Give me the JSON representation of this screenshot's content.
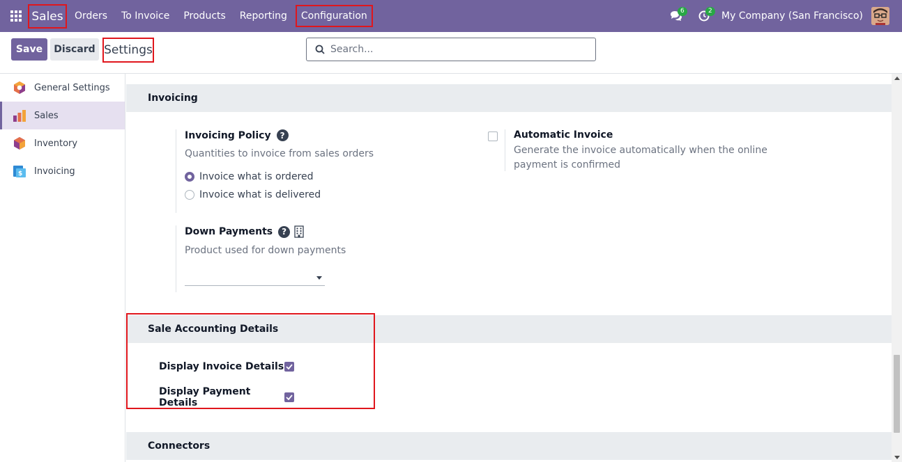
{
  "navbar": {
    "app_name": "Sales",
    "menu": [
      "Orders",
      "To Invoice",
      "Products",
      "Reporting",
      "Configuration"
    ],
    "messages_count": "6",
    "activities_count": "2",
    "company": "My Company (San Francisco)"
  },
  "control": {
    "save_label": "Save",
    "discard_label": "Discard",
    "title": "Settings",
    "search_placeholder": "Search..."
  },
  "sidebar": {
    "items": [
      {
        "label": "General Settings",
        "icon": "settings-hexagon-icon"
      },
      {
        "label": "Sales",
        "icon": "sales-chart-icon",
        "active": true
      },
      {
        "label": "Inventory",
        "icon": "inventory-box-icon"
      },
      {
        "label": "Invoicing",
        "icon": "invoicing-icon"
      }
    ]
  },
  "invoicing": {
    "header": "Invoicing",
    "policy_title": "Invoicing Policy",
    "policy_desc": "Quantities to invoice from sales orders",
    "option_ordered": "Invoice what is ordered",
    "option_delivered": "Invoice what is delivered",
    "selected_option": "Invoice what is ordered",
    "auto_invoice_title": "Automatic Invoice",
    "auto_invoice_desc": "Generate the invoice automatically when the online payment is confirmed",
    "auto_invoice_checked": false,
    "down_payments_title": "Down Payments",
    "down_payments_desc": "Product used for down payments",
    "down_payments_value": ""
  },
  "sale_accounting": {
    "header": "Sale Accounting Details",
    "invoice_details_label": "Display Invoice Details",
    "invoice_details_checked": true,
    "payment_details_label": "Display Payment Details",
    "payment_details_checked": true
  },
  "connectors": {
    "header": "Connectors"
  },
  "colors": {
    "brand": "#71639e",
    "highlight": "#e0161c",
    "badge": "#28a745"
  }
}
